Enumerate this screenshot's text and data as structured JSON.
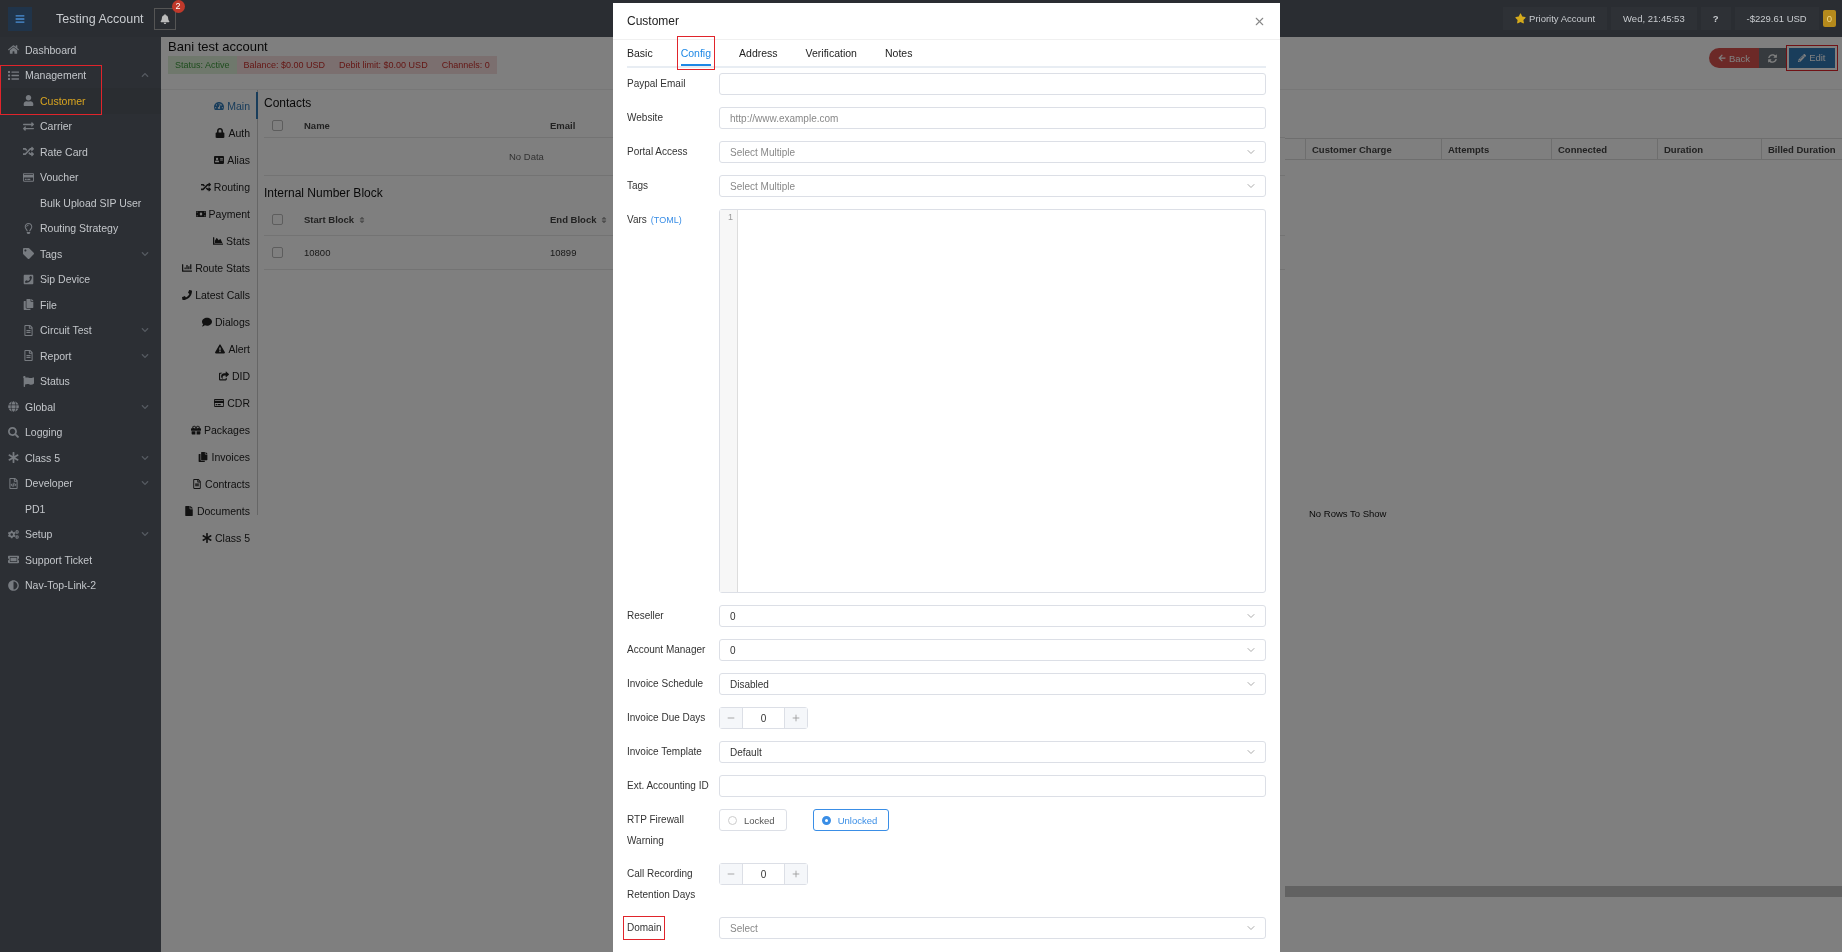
{
  "topbar": {
    "title": "Testing Account",
    "notifications": "2",
    "priority": "Priority Account",
    "clock": "Wed, 21:45:53",
    "help": "?",
    "balance": "-$229.61 USD",
    "badge": "0"
  },
  "sidebar": {
    "items": [
      {
        "label": "Dashboard",
        "selected": false
      },
      {
        "label": "Management",
        "selected": false,
        "expanded": true,
        "highlighted": true,
        "children": [
          {
            "label": "Customer",
            "selected": true
          },
          {
            "label": "Carrier",
            "selected": false
          },
          {
            "label": "Rate Card",
            "selected": false
          },
          {
            "label": "Voucher",
            "selected": false
          },
          {
            "label": "Bulk Upload SIP User",
            "selected": false
          },
          {
            "label": "Routing Strategy",
            "selected": false
          },
          {
            "label": "Tags",
            "selected": false,
            "expanded": false
          },
          {
            "label": "Sip Device",
            "selected": false
          },
          {
            "label": "File",
            "selected": false
          },
          {
            "label": "Circuit Test",
            "selected": false,
            "expanded": false
          },
          {
            "label": "Report",
            "selected": false,
            "expanded": false
          },
          {
            "label": "Status",
            "selected": false
          }
        ]
      },
      {
        "label": "Global",
        "selected": false,
        "expanded": false
      },
      {
        "label": "Logging",
        "selected": false
      },
      {
        "label": "Class 5",
        "selected": false,
        "expanded": false
      },
      {
        "label": "Developer",
        "selected": false,
        "expanded": false
      },
      {
        "label": "PD1",
        "selected": false
      },
      {
        "label": "Setup",
        "selected": false,
        "expanded": false
      },
      {
        "label": "Support Ticket",
        "selected": false
      },
      {
        "label": "Nav-Top-Link-2",
        "selected": false
      }
    ]
  },
  "page": {
    "title": "Bani test account",
    "tags": [
      {
        "label": "Status: Active",
        "kind": "success"
      },
      {
        "label": "Balance: $0.00 USD",
        "kind": "danger"
      },
      {
        "label": "Debit limit: $0.00 USD",
        "kind": "danger"
      },
      {
        "label": "Channels: 0",
        "kind": "danger"
      }
    ],
    "actions": [
      {
        "kind": "back",
        "label": "Back"
      },
      {
        "kind": "refresh"
      },
      {
        "kind": "edit",
        "label": "Edit",
        "highlighted": true
      }
    ],
    "subnav": [
      {
        "label": "Main",
        "selected": true
      },
      {
        "label": "Auth",
        "selected": false
      },
      {
        "label": "Alias",
        "selected": false
      },
      {
        "label": "Routing",
        "selected": false
      },
      {
        "label": "Payment",
        "selected": false
      },
      {
        "label": "Stats",
        "selected": false
      },
      {
        "label": "Route Stats",
        "selected": false
      },
      {
        "label": "Latest Calls",
        "selected": false
      },
      {
        "label": "Dialogs",
        "selected": false
      },
      {
        "label": "Alert",
        "selected": false
      },
      {
        "label": "DID",
        "selected": false
      },
      {
        "label": "CDR",
        "selected": false
      },
      {
        "label": "Packages",
        "selected": false
      },
      {
        "label": "Invoices",
        "selected": false
      },
      {
        "label": "Contracts",
        "selected": false
      },
      {
        "label": "Documents",
        "selected": false
      },
      {
        "label": "Class 5",
        "selected": false
      }
    ],
    "contacts": {
      "title": "Contacts",
      "header_checked": false,
      "columns": [
        "Name",
        "Email"
      ],
      "empty": "No Data"
    },
    "number_block": {
      "title": "Internal Number Block",
      "header_checked": false,
      "columns": [
        "Start Block",
        "End Block"
      ],
      "rows": [
        {
          "checked": false,
          "cells": [
            "10800",
            "10899"
          ]
        }
      ]
    },
    "calls": {
      "columns": [
        "Customer Charge",
        "Attempts",
        "Connected",
        "Duration",
        "Billed Duration"
      ],
      "empty": "No Rows To Show"
    }
  },
  "modal": {
    "title": "Customer",
    "tabs": [
      {
        "label": "Basic",
        "selected": false
      },
      {
        "label": "Config",
        "selected": true,
        "highlighted": true
      },
      {
        "label": "Address",
        "selected": false
      },
      {
        "label": "Verification",
        "selected": false
      },
      {
        "label": "Notes",
        "selected": false
      }
    ],
    "fields": [
      {
        "kind": "text",
        "label": "Paypal Email"
      },
      {
        "kind": "text",
        "label": "Website",
        "placeholder": "http://www.example.com"
      },
      {
        "kind": "select",
        "label": "Portal Access",
        "placeholder": "Select Multiple"
      },
      {
        "kind": "select",
        "label": "Tags",
        "placeholder": "Select Multiple"
      },
      {
        "kind": "code",
        "label": "Vars",
        "note": "(TOML)",
        "line_numbers": [
          "1"
        ]
      },
      {
        "kind": "select",
        "label": "Reseller",
        "value": "0"
      },
      {
        "kind": "select",
        "label": "Account Manager",
        "value": "0"
      },
      {
        "kind": "select",
        "label": "Invoice Schedule",
        "value": "Disabled"
      },
      {
        "kind": "number",
        "label": "Invoice Due Days",
        "value": "0"
      },
      {
        "kind": "select",
        "label": "Invoice Template",
        "value": "Default"
      },
      {
        "kind": "text",
        "label": "Ext. Accounting ID"
      },
      {
        "kind": "radio",
        "label": "RTP Firewall Warning",
        "options": [
          {
            "label": "Locked",
            "selected": false
          },
          {
            "label": "Unlocked",
            "selected": true
          }
        ]
      },
      {
        "kind": "number",
        "label": "Call Recording Retention Days",
        "value": "0"
      },
      {
        "kind": "select",
        "label": "Domain",
        "placeholder": "Select",
        "highlighted": true
      }
    ]
  }
}
